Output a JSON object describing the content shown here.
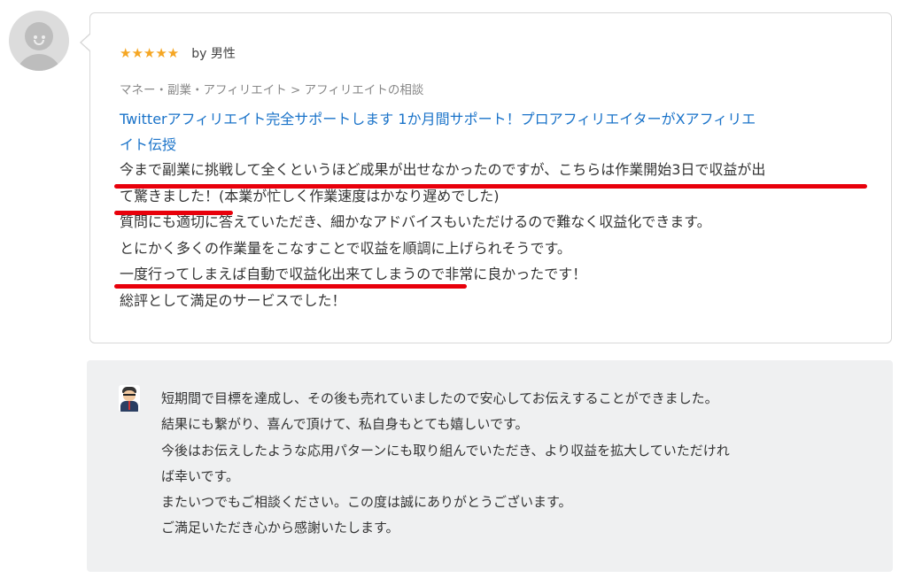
{
  "reviewer": {
    "avatar_icon": "default-user-avatar-icon",
    "stars": "★★★★★",
    "rating": 5,
    "by_label": "by 男性"
  },
  "review": {
    "category": "マネー・副業・アフィリエイト > アフィリエイトの相談",
    "service_title_line1": "Twitterアフィリエイト完全サポートします 1か月間サポート！プロアフィリエイターがXアフィリエ",
    "service_title_line2": "イト伝授",
    "lines": [
      "今まで副業に挑戦して全くというほど成果が出せなかったのですが、こちらは作業開始3日で収益が出",
      "て驚きました！(本業が忙しく作業速度はかなり遅めでした)",
      "質問にも適切に答えていただき、細かなアドバイスもいただけるので難なく収益化できます。",
      "とにかく多くの作業量をこなすことで収益を順調に上げられそうです。",
      "一度行ってしまえば自動で収益化出来てしまうので非常に良かったです！",
      "総評として満足のサービスでした！"
    ],
    "highlight_color": "#e8000b",
    "link_color": "#1a73c9",
    "star_color": "#f5a623"
  },
  "reply": {
    "seller_icon": "seller-avatar-icon",
    "lines": [
      "短期間で目標を達成し、その後も売れていましたので安心してお伝えすることができました。",
      "結果にも繋がり、喜んで頂けて、私自身もとても嬉しいです。",
      "今後はお伝えしたような応用パターンにも取り組んでいただき、より収益を拡大していただけれ",
      "ば幸いです。",
      "またいつでもご相談ください。この度は誠にありがとうございます。",
      "ご満足いただき心から感謝いたします。"
    ],
    "background": "#eff0f1"
  }
}
